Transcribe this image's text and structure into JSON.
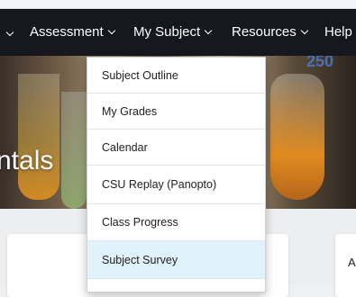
{
  "nav": {
    "items": [
      {
        "label": "Assessment",
        "has_chevron": true
      },
      {
        "label": "My Subject",
        "has_chevron": true
      },
      {
        "label": "Resources",
        "has_chevron": true
      },
      {
        "label": "Help",
        "has_chevron": false
      }
    ]
  },
  "hero": {
    "title": "ntals",
    "flask_marking": "250"
  },
  "dropdown": {
    "items": [
      {
        "label": "Subject Outline"
      },
      {
        "label": "My Grades"
      },
      {
        "label": "Calendar"
      },
      {
        "label": "CSU Replay (Panopto)"
      },
      {
        "label": "Class Progress"
      },
      {
        "label": "Subject Survey",
        "highlighted": true
      }
    ]
  },
  "content": {
    "right_card_label": "A"
  },
  "colors": {
    "navbar_bg": "#15181c",
    "menu_highlight": "#e0f2fb"
  }
}
